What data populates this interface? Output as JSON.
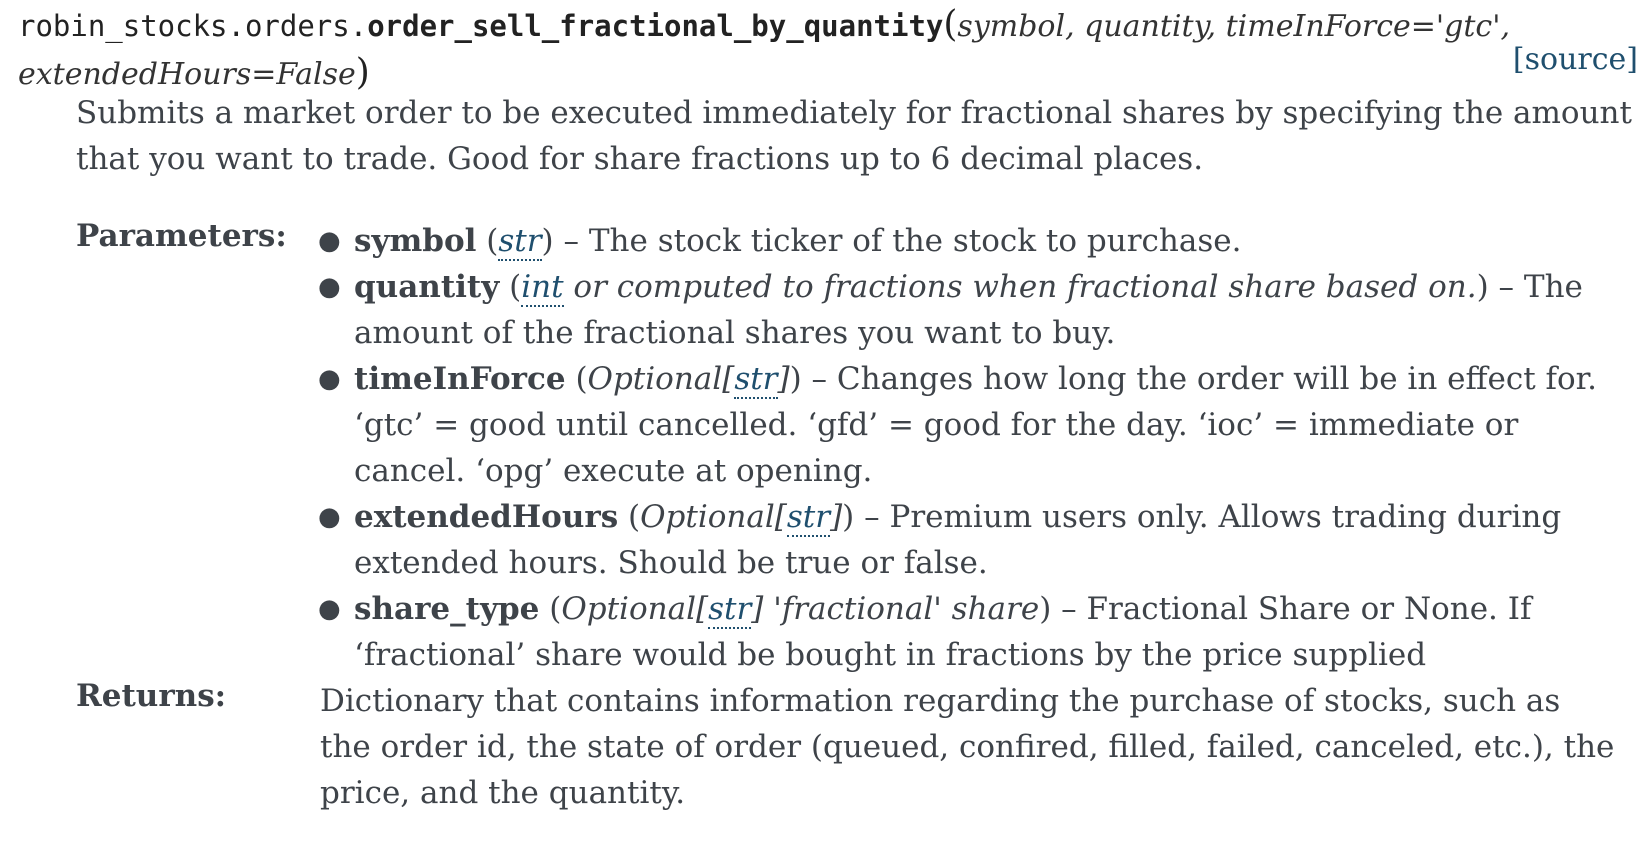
{
  "signature": {
    "module": "robin_stocks.orders.",
    "function_name": "order_sell_fractional_by_quantity",
    "open_paren": "(",
    "params_line1": "symbol, quantity, timeInForce='gtc',",
    "params_line2": "extendedHours=False",
    "close_paren": ")",
    "source_link": "[source]"
  },
  "description": "Submits a market order to be executed immediately for fractional shares by specifying the amount that you want to trade. Good for share fractions up to 6 decimal places.",
  "parameters_label": "Parameters:",
  "parameters": [
    {
      "name": "symbol",
      "type_prefix": "",
      "type_link": "str",
      "type_suffix": "",
      "description": "The stock ticker of the stock to purchase."
    },
    {
      "name": "quantity",
      "type_prefix": "",
      "type_link": "int",
      "type_suffix": " or computed to fractions when fractional share based on.",
      "description": "The amount of the fractional shares you want to buy."
    },
    {
      "name": "timeInForce",
      "type_prefix": "Optional[",
      "type_link": "str",
      "type_suffix": "]",
      "description": "Changes how long the order will be in effect for. ‘gtc’ = good until cancelled. ‘gfd’ = good for the day. ‘ioc’ = immediate or cancel. ‘opg’ execute at opening."
    },
    {
      "name": "extendedHours",
      "type_prefix": "Optional[",
      "type_link": "str",
      "type_suffix": "]",
      "description": "Premium users only. Allows trading during extended hours. Should be true or false."
    },
    {
      "name": "share_type",
      "type_prefix": "Optional[",
      "type_link": "str",
      "type_suffix": "] 'fractional' share",
      "description": "Fractional Share or None. If ‘fractional’ share would be bought in fractions by the price supplied"
    }
  ],
  "returns_label": "Returns:",
  "returns": "Dictionary that contains information regarding the purchase of stocks, such as the order id, the state of order (queued, confired, filled, failed, canceled, etc.), the price, and the quantity.",
  "colors": {
    "text": "#3e4349",
    "link": "#1f4f6e"
  }
}
